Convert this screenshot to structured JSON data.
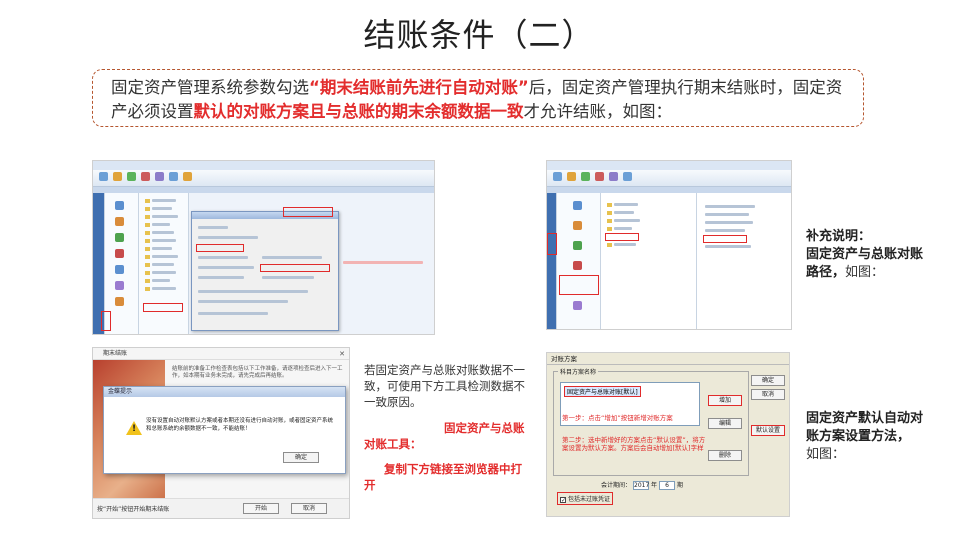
{
  "page": {
    "title": "结账条件（二）"
  },
  "intro": {
    "part1": "固定资产管理系统参数勾选",
    "highlight1": "“期末结账前先进行自动对账”",
    "part2": "后，固定资产管理执行期末结账时，固定资产必须设置",
    "highlight2": "默认的对账方案且与总账的期末余额数据一致",
    "part3": "才允许结账，如图："
  },
  "shot_c": {
    "window_title": "期末结账",
    "close_glyph": "✕",
    "warning_text": "结账前的准备工作检查表包括以下工作准备，请逐项检查后进入下一工作，如本期有业务未完成，请先完成后再结账。",
    "alert_title": "金蝶提示",
    "alert_message": "没有设置自动对账默认方案或者本期还没有进行自动对账，或者固定资产系统和总账系统的余额数据不一致，不能结账！",
    "alert_ok": "确定",
    "footer_hint": "按“开始”按钮开始期末结账",
    "start_button": "开始",
    "cancel_button": "取消"
  },
  "captions": {
    "middle_text": "若固定资产与总账对账数据不一致，可使用下方工具检测数据不一致原因。",
    "tool_label": "固定资产与总账对账工具：",
    "tool_action": "复制下方链接至浏览器中打开",
    "supplement_label": "补充说明：",
    "supplement_bold": "固定资产与总账对账路径，",
    "supplement_tail": "如图：",
    "default_label": "固定资产默认自动对账方案设置方法，",
    "default_tail": "如图："
  },
  "shot_d": {
    "window_title": "对账方案",
    "group_label": "科目方案名称",
    "list_item": "固定资产与总账对账[默认]",
    "btn_ok": "确定",
    "btn_cancel": "取消",
    "btn_add": "增加",
    "btn_edit": "编辑",
    "btn_default": "默认设置",
    "btn_delete": "删除",
    "step1": "第一步：点击“增加”按钮新增对账方案",
    "step2": "第二步：选中新增好的方案点击“默认设置”，将方案设置为默认方案。方案后会自动增加[默认]字样",
    "period_label": "会计期间：",
    "year": "2017",
    "year_unit": "年",
    "period": "6",
    "period_unit": "期",
    "checkbox_label": "包括未过账凭证"
  },
  "colors": {
    "accent_red": "#e32d2d",
    "box_border": "#b5562f"
  }
}
